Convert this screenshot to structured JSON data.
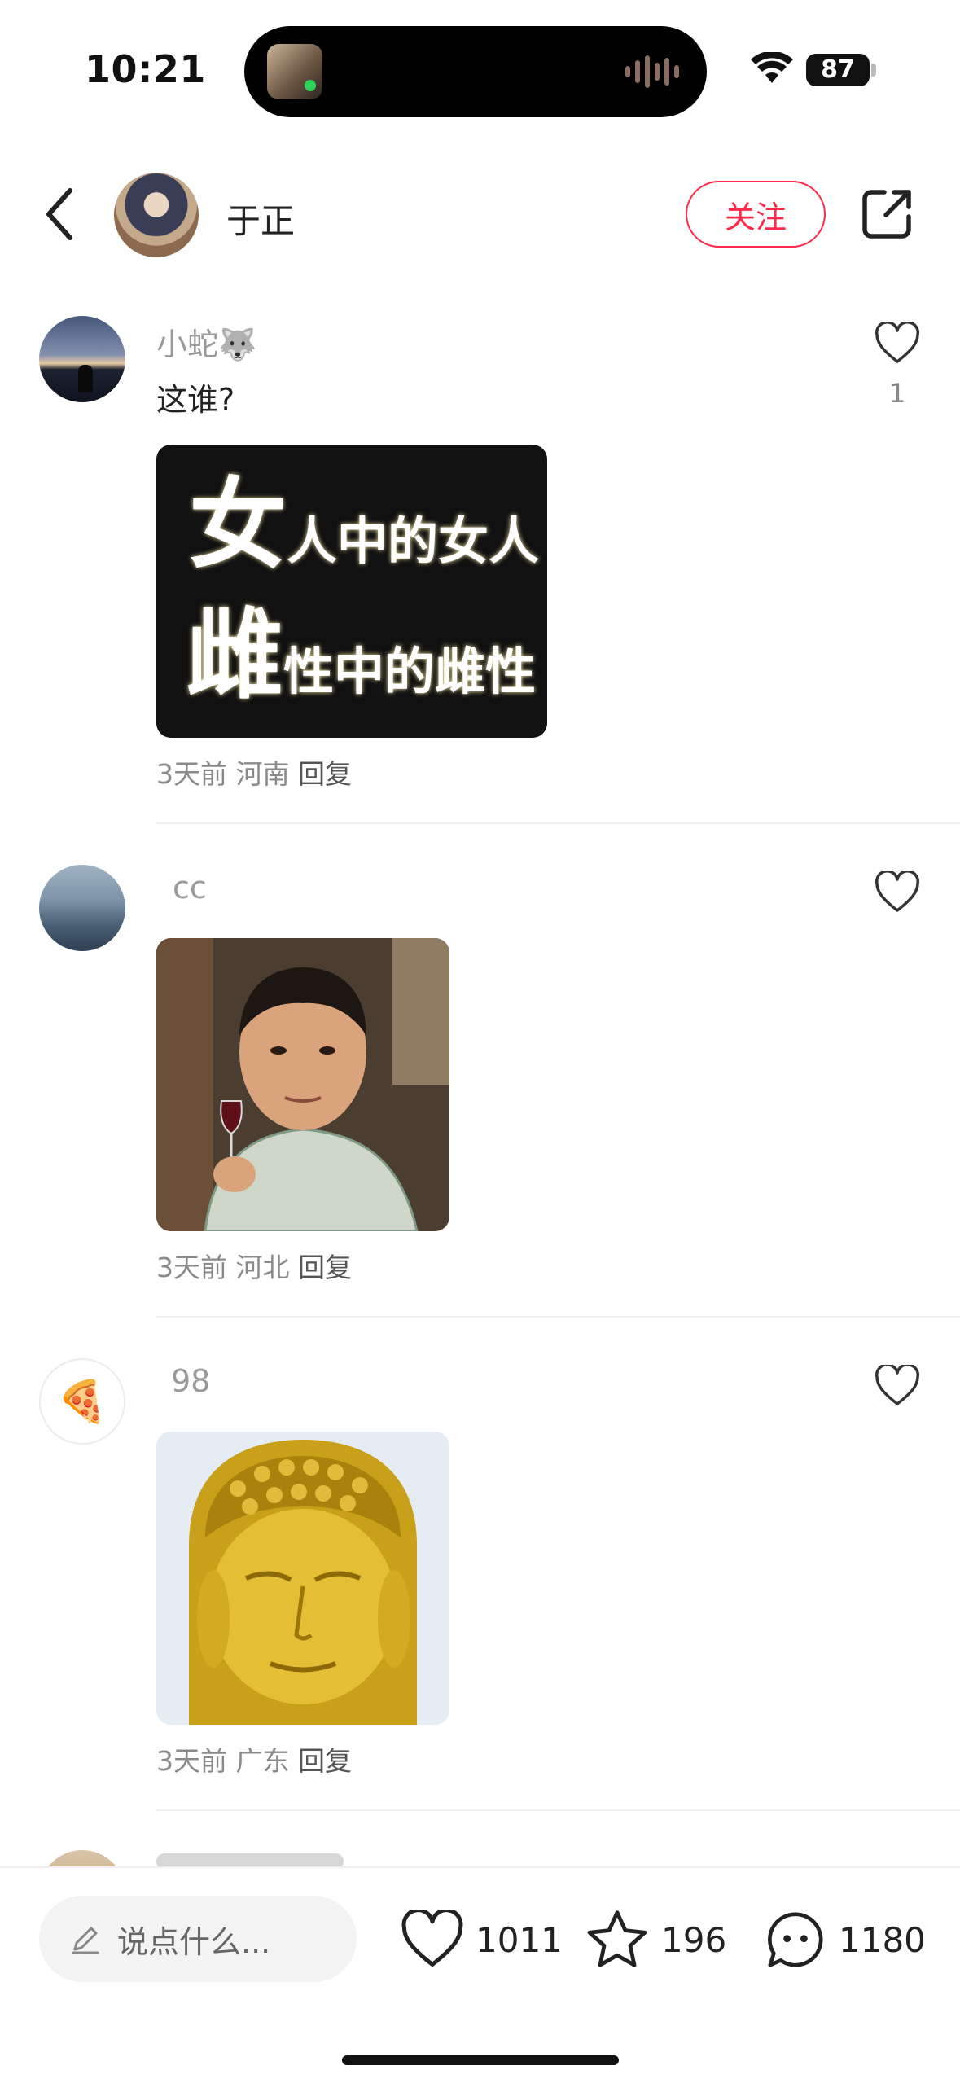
{
  "status_bar": {
    "time": "10:21",
    "battery": "87"
  },
  "header": {
    "author_name": "于正",
    "follow_label": "关注"
  },
  "comments": [
    {
      "username": "小蛇🐺",
      "text": "这谁?",
      "likes": "1",
      "image_text": [
        "女",
        "人中的女人",
        "雌",
        "性中的雌性"
      ],
      "time": "3天前",
      "location": "河南",
      "reply": "回复"
    },
    {
      "username": "cc",
      "time": "3天前",
      "location": "河北",
      "reply": "回复"
    },
    {
      "username": "98",
      "avatar_emoji": "🍕",
      "time": "3天前",
      "location": "广东",
      "reply": "回复"
    }
  ],
  "bottom_bar": {
    "input_placeholder": "说点什么...",
    "likes": "1011",
    "favorites": "196",
    "comments": "1180"
  },
  "colors": {
    "accent": "#ff2a4a"
  }
}
